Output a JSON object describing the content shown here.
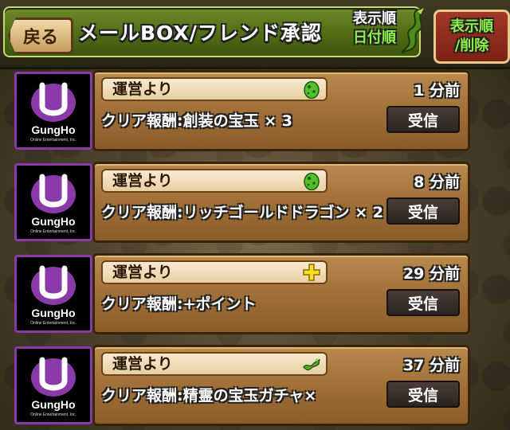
{
  "header": {
    "back_label": "戻る",
    "title": "メールBOX/フレンド承認",
    "sort_label": "表示順",
    "sort_value": "日付順",
    "sort_button_line1": "表示順",
    "sort_button_line2": "/削除"
  },
  "mails": [
    {
      "brand": "GungHo",
      "brand_sub": "Online Entertainment, Inc.",
      "sender": "運営より",
      "icon": "green-egg-icon",
      "time": "1 分前",
      "subject": "クリア報酬:創装の宝玉 × 3",
      "action": "受信"
    },
    {
      "brand": "GungHo",
      "brand_sub": "Online Entertainment, Inc.",
      "sender": "運営より",
      "icon": "green-egg-icon",
      "time": "8 分前",
      "subject": "クリア報酬:リッチゴールドドラゴン × 2",
      "action": "受信"
    },
    {
      "brand": "GungHo",
      "brand_sub": "Online Entertainment, Inc.",
      "sender": "運営より",
      "icon": "plus-icon",
      "time": "29 分前",
      "subject": "クリア報酬:+ポイント",
      "action": "受信"
    },
    {
      "brand": "GungHo",
      "brand_sub": "Online Entertainment, Inc.",
      "sender": "運営より",
      "icon": "dragon-icon",
      "time": "37 分前",
      "subject": "クリア報酬:精霊の宝玉ガチャ×",
      "action": "受信"
    }
  ],
  "colors": {
    "header_green": "#5a7a1c",
    "card_brown": "#a07038",
    "accent_green": "#8cf04a",
    "avatar_border": "#8a3aa8"
  }
}
